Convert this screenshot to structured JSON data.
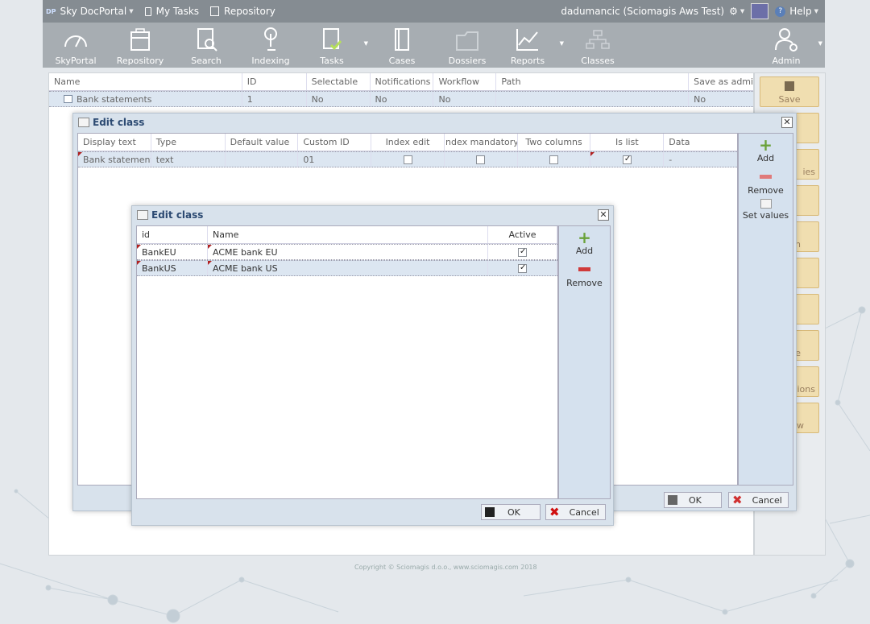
{
  "topbar": {
    "app_logo": "DP",
    "app_name": "Sky DocPortal",
    "my_tasks": "My Tasks",
    "repository": "Repository",
    "user": "dadumancic (Sciomagis Aws Test)",
    "help": "Help"
  },
  "ribbon": {
    "items": [
      {
        "label": "SkyPortal",
        "icon": "gauge-icon"
      },
      {
        "label": "Repository",
        "icon": "cabinet-icon"
      },
      {
        "label": "Search",
        "icon": "search-doc-icon"
      },
      {
        "label": "Indexing",
        "icon": "touch-icon"
      },
      {
        "label": "Tasks",
        "icon": "task-doc-icon"
      },
      {
        "label": "Cases",
        "icon": "book-icon"
      },
      {
        "label": "Dossiers",
        "icon": "folder-icon"
      },
      {
        "label": "Reports",
        "icon": "chart-icon"
      },
      {
        "label": "Classes",
        "icon": "hierarchy-icon"
      },
      {
        "label": "Admin",
        "icon": "admin-icon"
      }
    ]
  },
  "main_grid": {
    "columns": [
      "Name",
      "ID",
      "Selectable",
      "Notifications",
      "Workflow",
      "Path",
      "Save as admin."
    ],
    "rows": [
      {
        "name": "Bank statements",
        "id": "1",
        "selectable": "No",
        "notifications": "No",
        "workflow": "No",
        "path": "",
        "save_as_admin": "No"
      }
    ]
  },
  "side_panel": {
    "save": "Save",
    "partial_labels": [
      "ies",
      "n",
      "t",
      "ve",
      "ions",
      "ow"
    ]
  },
  "dialog1": {
    "title": "Edit class",
    "columns": [
      "Display text",
      "Type",
      "Default value",
      "Custom ID",
      "Index edit",
      "Index mandatory",
      "Two columns",
      "Is list",
      "Data"
    ],
    "rows": [
      {
        "display_text": "Bank statement",
        "type": "text",
        "default_value": "",
        "custom_id": "01",
        "index_edit": false,
        "index_mandatory": false,
        "two_columns": false,
        "is_list": true,
        "data": "-"
      }
    ],
    "tools": {
      "add": "Add",
      "remove": "Remove",
      "set_values": "Set values"
    },
    "ok": "OK",
    "cancel": "Cancel"
  },
  "dialog2": {
    "title": "Edit class",
    "columns": [
      "id",
      "Name",
      "Active"
    ],
    "rows": [
      {
        "id": "BankEU",
        "name": "ACME bank EU",
        "active": true
      },
      {
        "id": "BankUS",
        "name": "ACME bank US",
        "active": true
      }
    ],
    "tools": {
      "add": "Add",
      "remove": "Remove"
    },
    "ok": "OK",
    "cancel": "Cancel"
  },
  "footer": {
    "copyright": "Copyright © Sciomagis d.o.o., www.sciomagis.com 2018"
  },
  "colors": {
    "topbar": "#858c92",
    "ribbon": "#a7adb2",
    "dialog_bg": "#d8e2ec",
    "selected_row": "#dce6f1",
    "save_button": "#f0deb0"
  }
}
